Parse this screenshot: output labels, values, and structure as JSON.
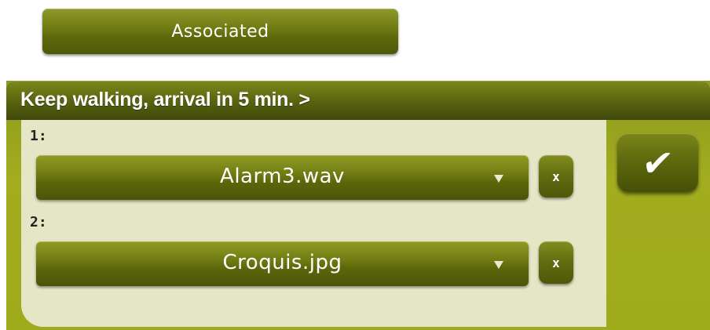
{
  "associated_button": {
    "label": "Associated"
  },
  "panel": {
    "title": "Keep walking, arrival in 5 min. >",
    "rows": [
      {
        "label": "1:",
        "value": "Alarm3.wav",
        "remove_label": "x"
      },
      {
        "label": "2:",
        "value": "Croquis.jpg",
        "remove_label": "x"
      }
    ],
    "confirm_icon": "checkmark-icon",
    "confirm_glyph": "✔"
  },
  "colors": {
    "olive_button": "#6e7a12",
    "olive_header": "#5a6510",
    "content_bg": "#e4e6c6",
    "panel_bg": "#a3ad1f"
  }
}
